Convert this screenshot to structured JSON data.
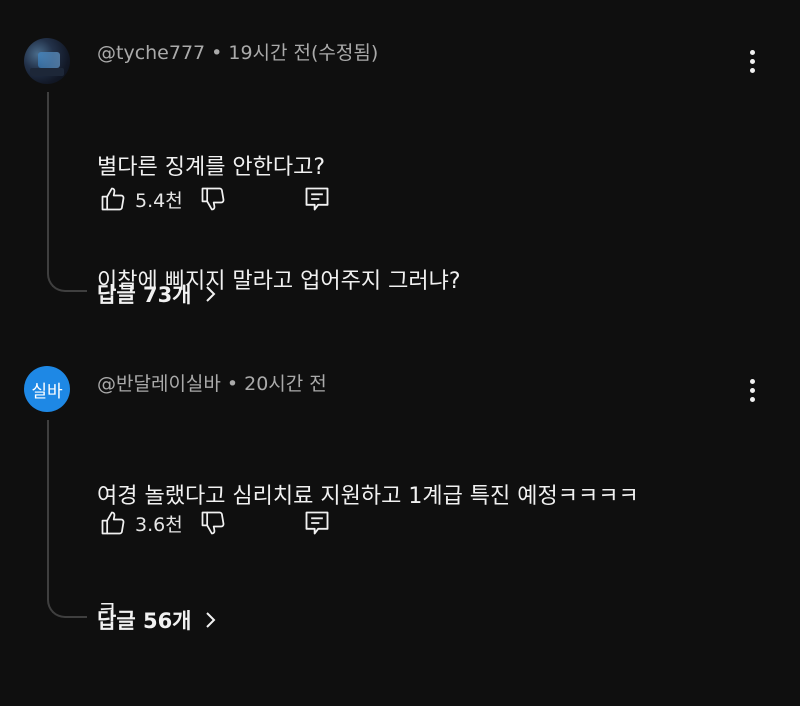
{
  "comments": [
    {
      "author": "@tyche777",
      "time": "19시간 전(수정됨)",
      "line1": "별다른 징계를 안한다고?",
      "line2": "이참에 삐지지 말라고 업어주지 그러냐?",
      "likes": "5.4천",
      "replies_label": "답글 73개",
      "avatar_icon": "user-photo-avatar"
    },
    {
      "author": "@반달레이실바",
      "time": "20시간 전",
      "line1": "여경 놀랬다고 심리치료 지원하고 1계급 특진 예정ㅋㅋㅋㅋ",
      "line2": "ㅋ",
      "likes": "3.6천",
      "replies_label": "답글 56개",
      "avatar_text": "실바",
      "avatar_color": "#1e88e5"
    }
  ],
  "separator": "•"
}
